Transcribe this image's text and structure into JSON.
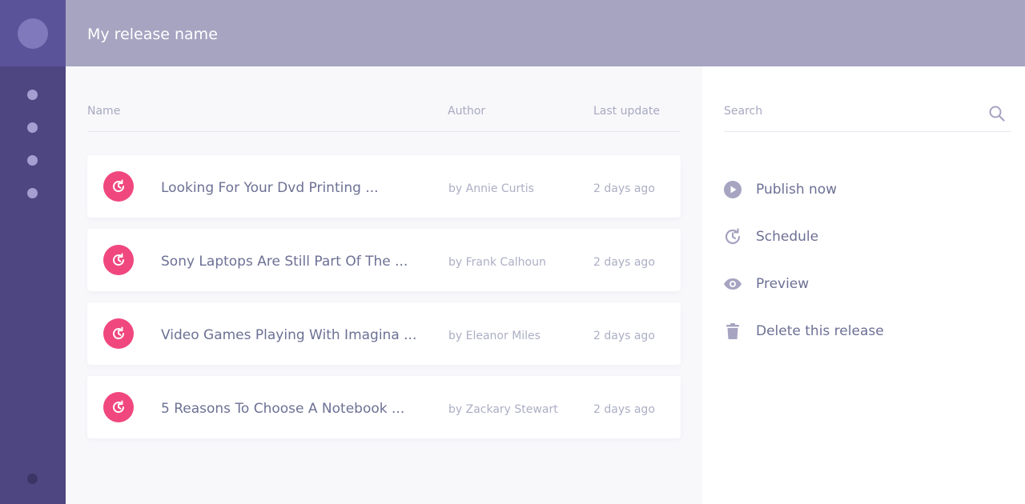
{
  "header": {
    "title": "My release name"
  },
  "sidebar": {
    "items": [
      "nav-1",
      "nav-2",
      "nav-3",
      "nav-4"
    ]
  },
  "table": {
    "columns": {
      "name": "Name",
      "author": "Author",
      "last_update": "Last update"
    },
    "rows": [
      {
        "title": "Looking For Your Dvd Printing ...",
        "author": "by Annie Curtis",
        "date": "2 days ago"
      },
      {
        "title": "Sony Laptops Are Still Part Of The ...",
        "author": "by Frank Calhoun",
        "date": "2 days ago"
      },
      {
        "title": "Video Games Playing With Imagina ...",
        "author": "by Eleanor Miles",
        "date": "2 days ago"
      },
      {
        "title": "5 Reasons To Choose A Notebook ...",
        "author": "by Zackary Stewart",
        "date": "2 days ago"
      }
    ]
  },
  "panel": {
    "search": {
      "placeholder": "Search",
      "value": ""
    },
    "actions": [
      {
        "label": "Publish now",
        "icon": "play-icon"
      },
      {
        "label": "Schedule",
        "icon": "schedule-icon"
      },
      {
        "label": "Preview",
        "icon": "eye-icon"
      },
      {
        "label": "Delete this release",
        "icon": "trash-icon"
      }
    ]
  },
  "colors": {
    "sidebar": "#4d4680",
    "header": "#a6a4c1",
    "accent": "#f0477f",
    "text": "#6c7194",
    "muted": "#acafc4"
  }
}
